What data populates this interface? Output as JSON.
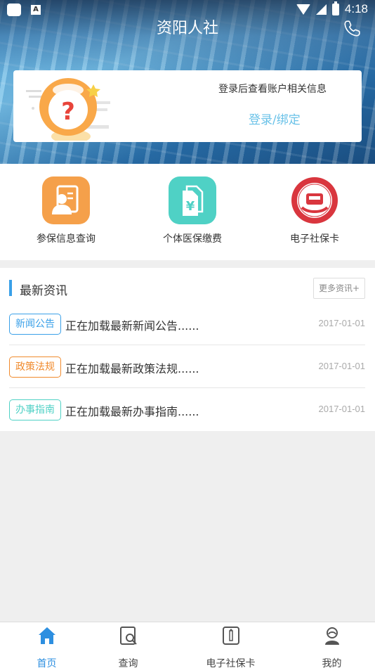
{
  "status_bar": {
    "time": "4:18"
  },
  "header": {
    "title": "资阳人社"
  },
  "login_card": {
    "hint": "登录后查看账户相关信息",
    "link": "登录/绑定"
  },
  "quick_actions": [
    {
      "label": "参保信息查询",
      "icon": "person-card-icon",
      "color": "#f5a04a"
    },
    {
      "label": "个体医保缴费",
      "icon": "yuan-document-icon",
      "color": "#4fd1c5"
    },
    {
      "label": "电子社保卡",
      "icon": "social-security-card-icon",
      "color": "#d9363e",
      "seal_text": "SOCIAL SECURITY CARD 社会保障卡"
    }
  ],
  "news": {
    "title": "最新资讯",
    "more": "更多资讯+",
    "items": [
      {
        "tag": "新闻公告",
        "tag_color": "#3aa0e8",
        "text": "正在加载最新新闻公告......",
        "date": "2017-01-01"
      },
      {
        "tag": "政策法规",
        "tag_color": "#f08a2c",
        "text": "正在加载最新政策法规......",
        "date": "2017-01-01"
      },
      {
        "tag": "办事指南",
        "tag_color": "#4fd1c5",
        "text": "正在加载最新办事指南......",
        "date": "2017-01-01"
      }
    ]
  },
  "bottom_nav": [
    {
      "label": "首页",
      "icon": "home-icon",
      "active": true
    },
    {
      "label": "查询",
      "icon": "search-document-icon",
      "active": false
    },
    {
      "label": "电子社保卡",
      "icon": "id-badge-icon",
      "active": false
    },
    {
      "label": "我的",
      "icon": "user-icon",
      "active": false
    }
  ]
}
